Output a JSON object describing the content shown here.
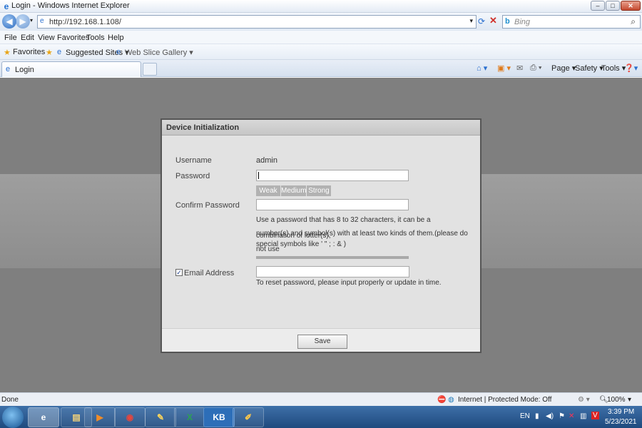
{
  "window": {
    "title": "Login - Windows Internet Explorer",
    "minimize": "‒",
    "maximize": "□",
    "close": "✕"
  },
  "address": {
    "url": "http://192.168.1.108/",
    "search_placeholder": "Bing"
  },
  "menu": [
    "File",
    "Edit",
    "View",
    "Favorites",
    "Tools",
    "Help"
  ],
  "favorites_bar": {
    "favorites": "Favorites",
    "suggested": "Suggested Sites ▾",
    "webslice": "Web Slice Gallery ▾"
  },
  "tab": {
    "label": "Login"
  },
  "command_bar": {
    "page": "Page ▾",
    "safety": "Safety ▾",
    "tools": "Tools ▾"
  },
  "dialog": {
    "title": "Device Initialization",
    "username_label": "Username",
    "username_value": "admin",
    "password_label": "Password",
    "password_value": "",
    "strength": [
      "Weak",
      "Medium",
      "Strong"
    ],
    "confirm_label": "Confirm Password",
    "confirm_value": "",
    "hint_lines": [
      "Use a password that has 8 to 32 characters, it can be a combination of letter(s),",
      "number(s) and symbol(s) with at least two kinds of them.(please do not use",
      "special symbols like ' \" ; : & )"
    ],
    "email_checked": true,
    "email_label": "Email Address",
    "email_value": "",
    "email_hint": "To reset password, please input properly or update in time.",
    "save_label": "Save"
  },
  "status": {
    "left": "Done",
    "zone": "Internet | Protected Mode: Off",
    "zoom": "100%"
  },
  "taskbar": {
    "kb_label": "KB",
    "lang": "EN",
    "time": "3:39 PM",
    "date": "5/23/2021"
  }
}
